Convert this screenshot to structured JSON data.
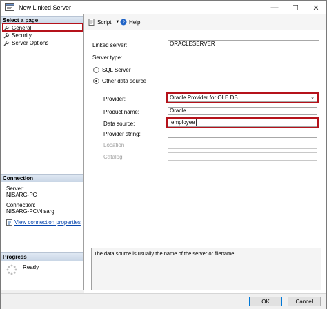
{
  "window": {
    "title": "New Linked Server",
    "minimize_glyph": "—",
    "maximize_glyph": "☐",
    "close_glyph": "✕"
  },
  "left_pane": {
    "select_page_header": "Select a page",
    "pages": [
      {
        "label": "General",
        "icon": "wrench-icon",
        "selected": true
      },
      {
        "label": "Security",
        "icon": "wrench-icon",
        "selected": false
      },
      {
        "label": "Server Options",
        "icon": "wrench-icon",
        "selected": false
      }
    ],
    "connection_header": "Connection",
    "server_label": "Server:",
    "server_value": "NISARG-PC",
    "connection_label": "Connection:",
    "connection_value": "NISARG-PC\\Nisarg",
    "view_properties_link": "View connection properties",
    "progress_header": "Progress",
    "progress_status": "Ready"
  },
  "toolbar": {
    "script_label": "Script",
    "help_label": "Help"
  },
  "form": {
    "linked_server_label": "Linked server:",
    "linked_server_value": "ORACLESERVER",
    "server_type_label": "Server type:",
    "sql_server_label": "SQL Server",
    "other_source_label": "Other data source",
    "selected_server_type": "Other data source",
    "provider_label": "Provider:",
    "provider_value": "Oracle Provider for OLE DB",
    "product_name_label": "Product name:",
    "product_name_value": "Oracle",
    "data_source_label": "Data source:",
    "data_source_value": "employee",
    "provider_string_label": "Provider string:",
    "provider_string_value": "",
    "location_label": "Location",
    "location_value": "",
    "catalog_label": "Catalog",
    "catalog_value": ""
  },
  "description": "The data source is usually the name of the server or filename.",
  "buttons": {
    "ok": "OK",
    "cancel": "Cancel"
  },
  "colors": {
    "highlight_outline": "#b5121b",
    "link": "#0645ad",
    "pane_header": "#c9d6e6"
  }
}
